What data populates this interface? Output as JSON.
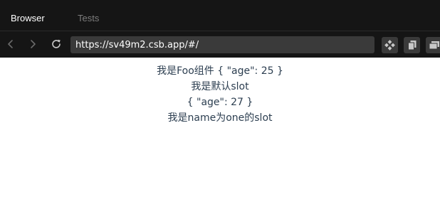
{
  "tabs": [
    {
      "label": "Browser",
      "active": true
    },
    {
      "label": "Tests",
      "active": false
    }
  ],
  "toolbar": {
    "back_icon": "chevron-left-icon",
    "forward_icon": "chevron-right-icon",
    "refresh_icon": "refresh-icon",
    "url": "https://sv49m2.csb.app/#/",
    "tool_icons": [
      "devtools-icon",
      "copy-icon",
      "open-window-icon"
    ]
  },
  "colors": {
    "chrome_bg": "#151515",
    "url_bg": "#3a3a3a",
    "active_tab_text": "#ffffff",
    "inactive_tab_text": "#7d7d7d",
    "page_text": "#2c3e50"
  },
  "page": {
    "lines": [
      "我是Foo组件 { \"age\": 25 }",
      "我是默认slot",
      "{ \"age\": 27 }",
      "我是name为one的slot"
    ]
  }
}
